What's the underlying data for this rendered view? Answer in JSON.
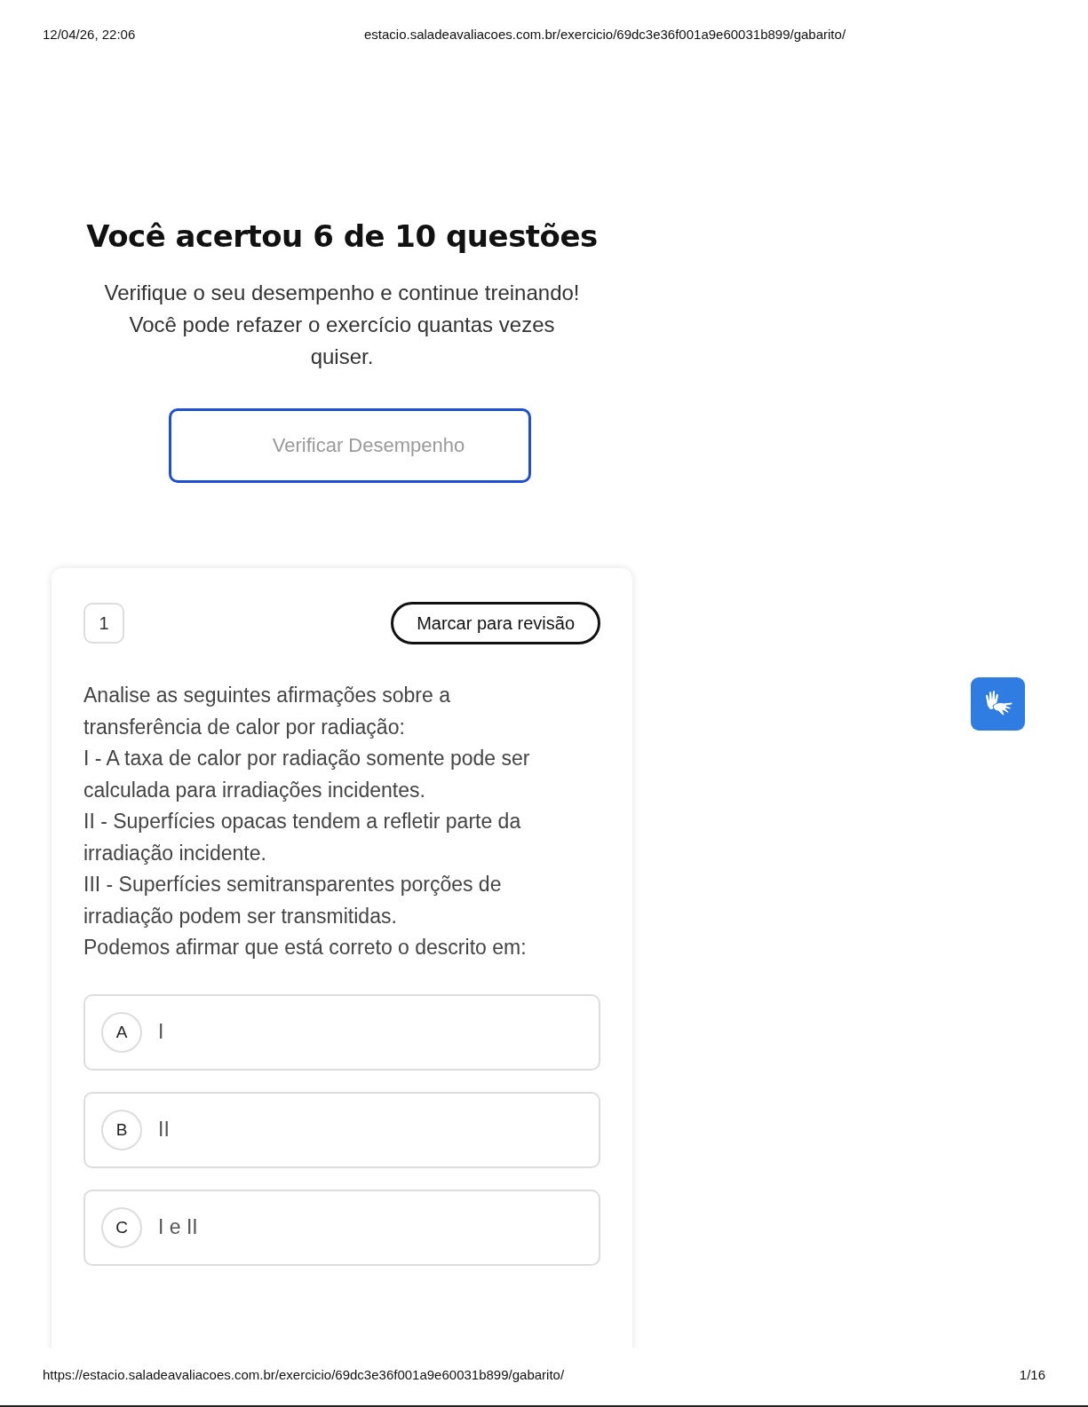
{
  "print_header": {
    "date": "12/04/26, 22:06",
    "url": "estacio.saladeavaliacoes.com.br/exercicio/69dc3e36f001a9e60031b899/gabarito/"
  },
  "summary": {
    "title": "Você acertou 6 de 10 questões",
    "message": [
      "Verifique o seu desempenho e continue treinando!",
      "Você pode refazer o exercício quantas vezes",
      "quiser."
    ],
    "button": "Verificar Desempenho"
  },
  "question": {
    "number": "1",
    "review_button": "Marcar para revisão",
    "prompt": [
      "Analise as seguintes afirmações sobre a",
      "transferência de calor por radiação:",
      "I - A taxa de calor por radiação somente pode ser",
      "calculada para irradiações incidentes.",
      "II - Superfícies opacas tendem a refletir parte da",
      "irradiação incidente.",
      "III - Superfícies semitransparentes porções de",
      "irradiação podem ser transmitidas.",
      "Podemos afirmar que está correto o descrito em:"
    ],
    "options": [
      {
        "letter": "A",
        "text": "I"
      },
      {
        "letter": "B",
        "text": "II"
      },
      {
        "letter": "C",
        "text": "I e II"
      }
    ]
  },
  "print_footer": {
    "url": "https://estacio.saladeavaliacoes.com.br/exercicio/69dc3e36f001a9e60031b899/gabarito/",
    "page": "1/16"
  }
}
